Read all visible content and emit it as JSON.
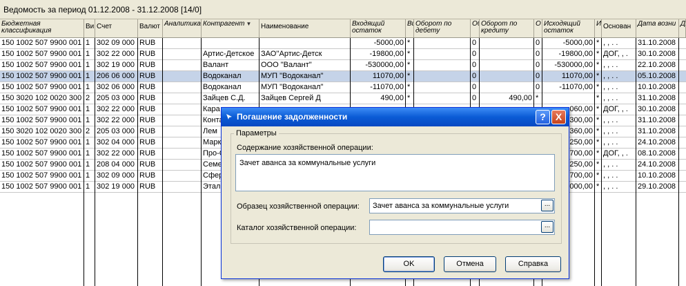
{
  "window": {
    "title": "Ведомость за период 01.12.2008 - 31.12.2008 [14/0]"
  },
  "table": {
    "columns": [
      "Бюджетная классификация",
      "Ви",
      "Счет",
      "Валют",
      "Аналитика",
      "Контрагент",
      "Наименование",
      "Входящий остаток",
      "Ви",
      "Оборот по дебету",
      "Об",
      "Оборот по кредиту",
      "О",
      "Исходящий остаток",
      "И",
      "Основан",
      "Дата возни",
      "Д"
    ],
    "rows": [
      [
        "150 1002 507 9900 001",
        "1",
        "302 09 000",
        "RUB",
        "",
        "",
        "",
        "-5000,00",
        "*",
        "",
        "0",
        "",
        "0",
        "-5000,00",
        "*",
        ", , . .",
        "31.10.2008"
      ],
      [
        "150 1002 507 9900 001",
        "1",
        "302 22 000",
        "RUB",
        "",
        "Артис-Детское",
        "ЗАО''Артис-Детск",
        "-19800,00",
        "*",
        "",
        "0",
        "",
        "0",
        "-19800,00",
        "*",
        "ДОГ, , .",
        "30.10.2008"
      ],
      [
        "150 1002 507 9900 001",
        "1",
        "302 19 000",
        "RUB",
        "",
        "Валант",
        "ООО \"Валант\"",
        "-530000,00",
        "*",
        "",
        "0",
        "",
        "0",
        "-530000,00",
        "*",
        ", , . .",
        "22.10.2008"
      ],
      [
        "150 1002 507 9900 001",
        "1",
        "206 06 000",
        "RUB",
        "",
        "Водоканал",
        "МУП \"Водоканал\"",
        "11070,00",
        "*",
        "",
        "0",
        "",
        "0",
        "11070,00",
        "*",
        ", , . .",
        "05.10.2008"
      ],
      [
        "150 1002 507 9900 001",
        "1",
        "302 06 000",
        "RUB",
        "",
        "Водоканал",
        "МУП \"Водоканал\"",
        "-11070,00",
        "*",
        "",
        "0",
        "",
        "0",
        "-11070,00",
        "*",
        ", , . .",
        "10.10.2008"
      ],
      [
        "150 3020 102 0020 300",
        "2",
        "205 03 000",
        "RUB",
        "",
        "Зайцев С.Д.",
        "Зайцев Сергей Д",
        "490,00",
        "*",
        "",
        "0",
        "490,00",
        "*",
        "",
        "*",
        ", , . .",
        "31.10.2008"
      ],
      [
        "150 1002 507 9900 001",
        "1",
        "302 22 000",
        "RUB",
        "",
        "Кара",
        "",
        "",
        "",
        "",
        "",
        "",
        "",
        "060,00",
        "*",
        "ДОГ, , .",
        "30.10.2008"
      ],
      [
        "150 1002 507 9900 001",
        "1",
        "302 22 000",
        "RUB",
        "",
        "Конта",
        "",
        "",
        "",
        "",
        "",
        "",
        "",
        "300,00",
        "*",
        ", , . .",
        "31.10.2008"
      ],
      [
        "150 3020 102 0020 300",
        "2",
        "205 03 000",
        "RUB",
        "",
        "Лем",
        "",
        "",
        "",
        "",
        "",
        "",
        "",
        "360,00",
        "*",
        ", , . .",
        "31.10.2008"
      ],
      [
        "150 1002 507 9900 001",
        "1",
        "302 04 000",
        "RUB",
        "",
        "Марк",
        "",
        "",
        "",
        "",
        "",
        "",
        "",
        "250,00",
        "*",
        ", , . .",
        "24.10.2008"
      ],
      [
        "150 1002 507 9900 001",
        "1",
        "302 22 000",
        "RUB",
        "",
        "Про-С",
        "",
        "",
        "",
        "",
        "",
        "",
        "",
        "700,00",
        "*",
        "ДОГ, , .",
        "08.10.2008"
      ],
      [
        "150 1002 507 9900 001",
        "1",
        "208 04 000",
        "RUB",
        "",
        "Семе",
        "",
        "",
        "",
        "",
        "",
        "",
        "",
        "250,00",
        "*",
        ", , . .",
        "24.10.2008"
      ],
      [
        "150 1002 507 9900 001",
        "1",
        "302 09 000",
        "RUB",
        "",
        "Сфер",
        "",
        "",
        "",
        "",
        "",
        "",
        "",
        "700,00",
        "*",
        ", , . .",
        "10.10.2008"
      ],
      [
        "150 1002 507 9900 001",
        "1",
        "302 19 000",
        "RUB",
        "",
        "Этало",
        "",
        "",
        "",
        "",
        "",
        "",
        "",
        "000,00",
        "*",
        ", , . .",
        "29.10.2008"
      ]
    ],
    "selected_row": 3
  },
  "dialog": {
    "title": "Погашение задолженности",
    "help_label": "?",
    "close_label": "X",
    "group_label": "Параметры",
    "content_label": "Содержание хозяйственной операции:",
    "content_value": "Зачет аванса за коммунальные услуги",
    "sample_label": "Образец хозяйственной операции:",
    "sample_value": "Зачет аванса за коммунальные услуги",
    "catalog_label": "Каталог хозяйственной операции:",
    "catalog_value": "",
    "dots_label": "...",
    "ok_label": "OK",
    "cancel_label": "Отмена",
    "help_button_label": "Справка"
  },
  "colors": {
    "selected_row": "#c5d3e8",
    "dialog_title": "#0a5bd5",
    "dialog_bg": "#ece9d8"
  }
}
